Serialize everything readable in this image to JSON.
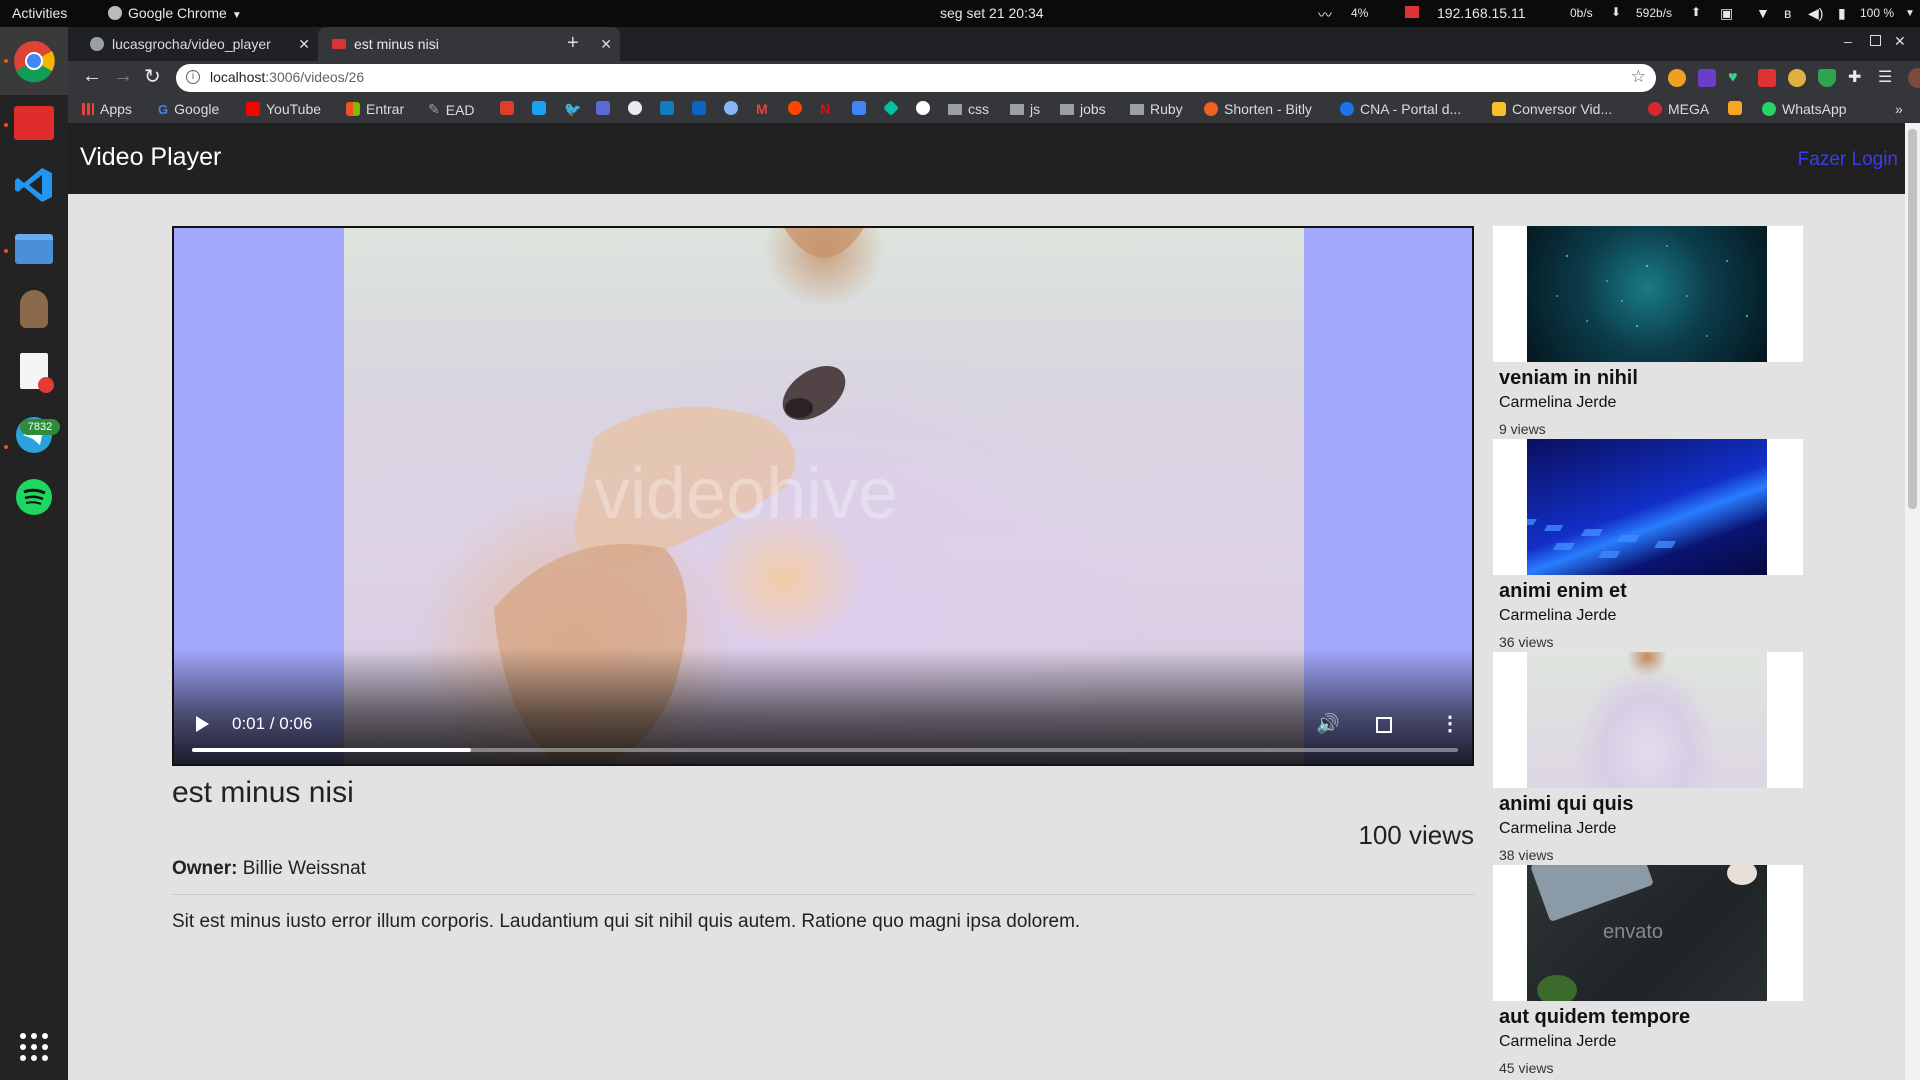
{
  "os": {
    "activities": "Activities",
    "app_menu": "Google Chrome",
    "clock": "seg set 21  20:34",
    "cpu": "4%",
    "ip": "192.168.15.11",
    "net_up": "0b/s",
    "net_down": "592b/s",
    "battery": "100 %",
    "dock_badge": "7832"
  },
  "browser": {
    "tabs": [
      {
        "label": "lucasgrocha/video_player",
        "active": false
      },
      {
        "label": "est minus nisi",
        "active": true
      }
    ],
    "url_host": "localhost",
    "url_path": ":3006/videos/26",
    "bookmarks": {
      "apps": "Apps",
      "google": "Google",
      "youtube": "YouTube",
      "entrar": "Entrar",
      "ead": "EAD",
      "css": "css",
      "js": "js",
      "jobs": "jobs",
      "ruby": "Ruby",
      "bitly": "Shorten - Bitly",
      "cna": "CNA - Portal d...",
      "conversor": "Conversor Vid...",
      "mega": "MEGA",
      "whatsapp": "WhatsApp"
    }
  },
  "app": {
    "brand": "Video Player",
    "login": "Fazer Login"
  },
  "player": {
    "time": "0:01 / 0:06",
    "progress": 0.22,
    "watermark": "videohive"
  },
  "video": {
    "title": "est minus nisi",
    "views": "100 views",
    "owner_label": "Owner:",
    "owner": "Billie Weissnat",
    "description": "Sit est minus iusto error illum corporis. Laudantium qui sit nihil quis autem. Ratione quo magni ipsa dolorem."
  },
  "related": [
    {
      "title": "veniam in nihil",
      "owner": "Carmelina Jerde",
      "views": "9 views"
    },
    {
      "title": "animi enim et",
      "owner": "Carmelina Jerde",
      "views": "36 views"
    },
    {
      "title": "animi qui quis",
      "owner": "Carmelina Jerde",
      "views": "38 views"
    },
    {
      "title": "aut quidem tempore",
      "owner": "Carmelina Jerde",
      "views": "45 views",
      "thumb_text": "envato"
    }
  ],
  "colors": {
    "navbar": "#212121",
    "link": "#3b3bf0",
    "letterbox": "#a3a8fd"
  }
}
